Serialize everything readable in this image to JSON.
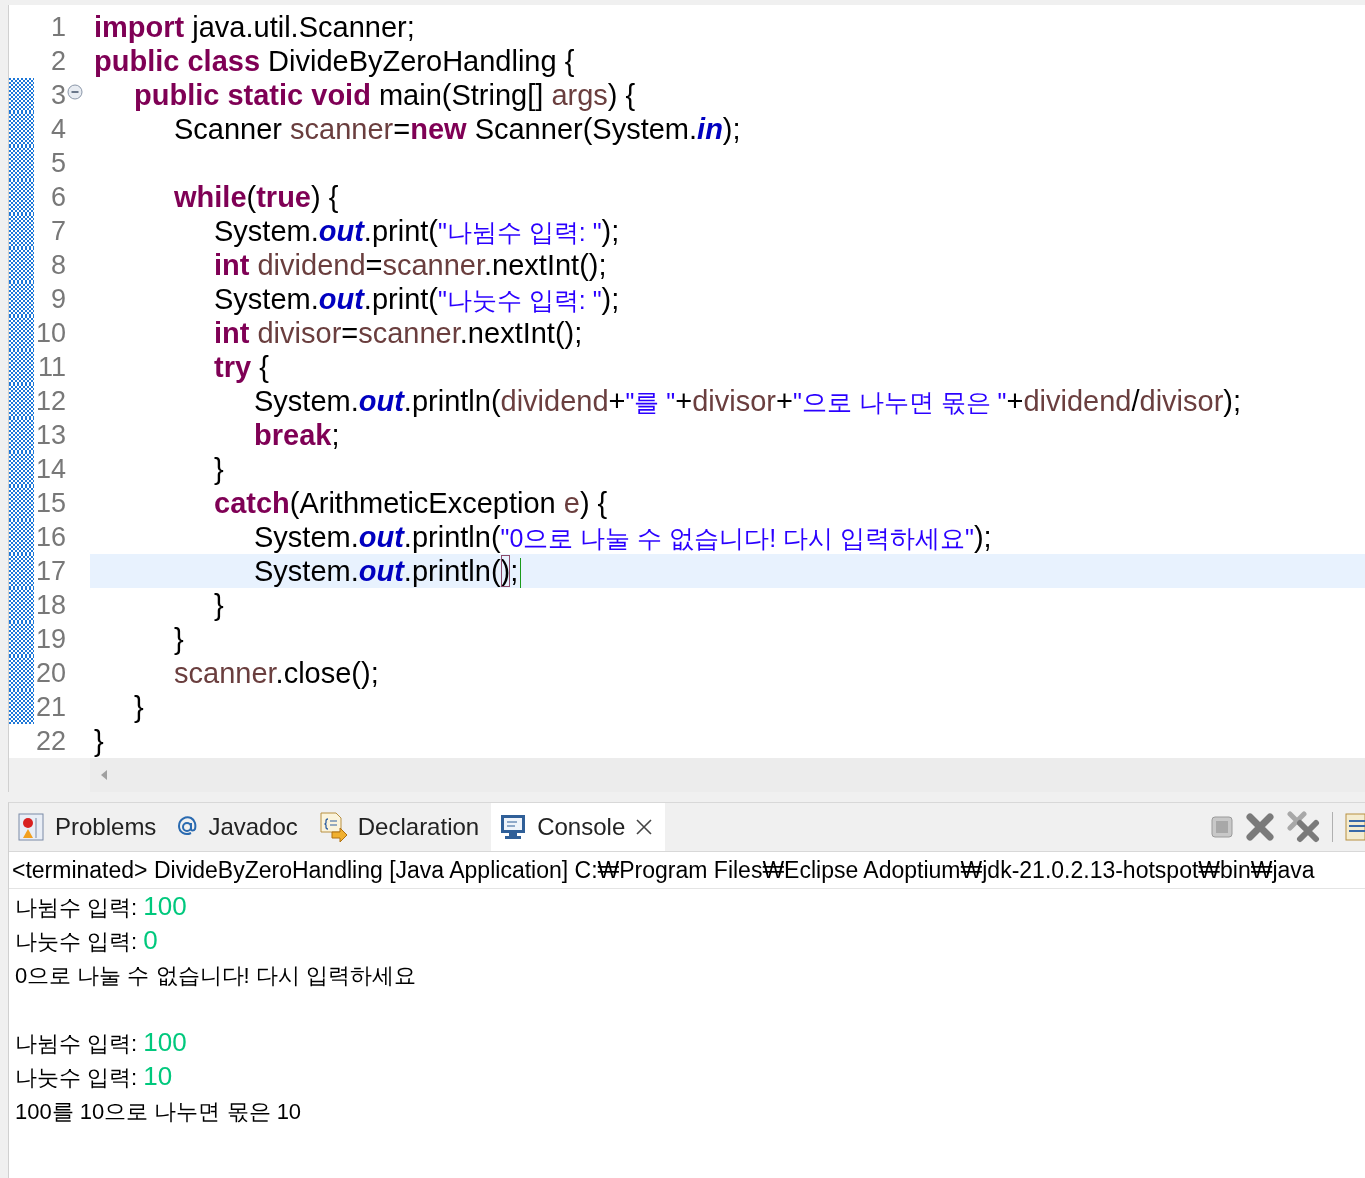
{
  "editor": {
    "lines": [
      {
        "number": "1",
        "changed": false,
        "current": false,
        "foldable": false,
        "tokens": [
          {
            "kind": "kw",
            "text": "import"
          },
          {
            "kind": "plain",
            "text": " java.util.Scanner;"
          }
        ]
      },
      {
        "number": "2",
        "changed": false,
        "current": false,
        "foldable": false,
        "tokens": [
          {
            "kind": "kw",
            "text": "public class"
          },
          {
            "kind": "plain",
            "text": " DivideByZeroHandling {"
          }
        ]
      },
      {
        "number": "3",
        "changed": true,
        "current": false,
        "foldable": true,
        "tokens": [
          {
            "kind": "kw",
            "text": "\tpublic static void"
          },
          {
            "kind": "plain",
            "text": " main(String[] "
          },
          {
            "kind": "var",
            "text": "args"
          },
          {
            "kind": "plain",
            "text": ") {"
          }
        ]
      },
      {
        "number": "4",
        "changed": true,
        "current": false,
        "foldable": false,
        "tokens": [
          {
            "kind": "plain",
            "text": "\t\tScanner "
          },
          {
            "kind": "var",
            "text": "scanner"
          },
          {
            "kind": "plain",
            "text": "="
          },
          {
            "kind": "kw",
            "text": "new"
          },
          {
            "kind": "plain",
            "text": " Scanner(System."
          },
          {
            "kind": "field",
            "text": "in"
          },
          {
            "kind": "plain",
            "text": ");"
          }
        ]
      },
      {
        "number": "5",
        "changed": true,
        "current": false,
        "foldable": false
      },
      {
        "number": "6",
        "changed": true,
        "current": false,
        "foldable": false,
        "tokens": [
          {
            "kind": "kw",
            "text": "\t\twhile"
          },
          {
            "kind": "plain",
            "text": "("
          },
          {
            "kind": "kw",
            "text": "true"
          },
          {
            "kind": "plain",
            "text": ") {"
          }
        ]
      },
      {
        "number": "7",
        "changed": true,
        "current": false,
        "foldable": false,
        "tokens": [
          {
            "kind": "plain",
            "text": "\t\t\tSystem."
          },
          {
            "kind": "field",
            "text": "out"
          },
          {
            "kind": "plain",
            "text": ".print("
          },
          {
            "kind": "str",
            "text": "\"나뉨수 입력: \""
          },
          {
            "kind": "plain",
            "text": ");"
          }
        ]
      },
      {
        "number": "8",
        "changed": true,
        "current": false,
        "foldable": false,
        "tokens": [
          {
            "kind": "kw",
            "text": "\t\t\tint"
          },
          {
            "kind": "var",
            "text": " dividend"
          },
          {
            "kind": "plain",
            "text": "="
          },
          {
            "kind": "var",
            "text": "scanner"
          },
          {
            "kind": "plain",
            "text": ".nextInt();"
          }
        ]
      },
      {
        "number": "9",
        "changed": true,
        "current": false,
        "foldable": false,
        "tokens": [
          {
            "kind": "plain",
            "text": "\t\t\tSystem."
          },
          {
            "kind": "field",
            "text": "out"
          },
          {
            "kind": "plain",
            "text": ".print("
          },
          {
            "kind": "str",
            "text": "\"나눗수 입력: \""
          },
          {
            "kind": "plain",
            "text": ");"
          }
        ]
      },
      {
        "number": "10",
        "changed": true,
        "current": false,
        "foldable": false,
        "tokens": [
          {
            "kind": "kw",
            "text": "\t\t\tint"
          },
          {
            "kind": "var",
            "text": " divisor"
          },
          {
            "kind": "plain",
            "text": "="
          },
          {
            "kind": "var",
            "text": "scanner"
          },
          {
            "kind": "plain",
            "text": ".nextInt();"
          }
        ]
      },
      {
        "number": "11",
        "changed": true,
        "current": false,
        "foldable": false,
        "tokens": [
          {
            "kind": "kw",
            "text": "\t\t\ttry"
          },
          {
            "kind": "plain",
            "text": " {"
          }
        ]
      },
      {
        "number": "12",
        "changed": true,
        "current": false,
        "foldable": false,
        "tokens": [
          {
            "kind": "plain",
            "text": "\t\t\t\tSystem."
          },
          {
            "kind": "field",
            "text": "out"
          },
          {
            "kind": "plain",
            "text": ".println("
          },
          {
            "kind": "var",
            "text": "dividend"
          },
          {
            "kind": "plain",
            "text": "+"
          },
          {
            "kind": "str",
            "text": "\"를 \""
          },
          {
            "kind": "plain",
            "text": "+"
          },
          {
            "kind": "var",
            "text": "divisor"
          },
          {
            "kind": "plain",
            "text": "+"
          },
          {
            "kind": "str",
            "text": "\"으로 나누면 몫은 \""
          },
          {
            "kind": "plain",
            "text": "+"
          },
          {
            "kind": "var",
            "text": "dividend"
          },
          {
            "kind": "plain",
            "text": "/"
          },
          {
            "kind": "var",
            "text": "divisor"
          },
          {
            "kind": "plain",
            "text": ");"
          }
        ]
      },
      {
        "number": "13",
        "changed": true,
        "current": false,
        "foldable": false,
        "tokens": [
          {
            "kind": "kw",
            "text": "\t\t\t\tbreak"
          },
          {
            "kind": "plain",
            "text": ";"
          }
        ]
      },
      {
        "number": "14",
        "changed": true,
        "current": false,
        "foldable": false,
        "tokens": [
          {
            "kind": "plain",
            "text": "\t\t\t}"
          }
        ]
      },
      {
        "number": "15",
        "changed": true,
        "current": false,
        "foldable": false,
        "tokens": [
          {
            "kind": "kw",
            "text": "\t\t\tcatch"
          },
          {
            "kind": "plain",
            "text": "(ArithmeticException "
          },
          {
            "kind": "var",
            "text": "e"
          },
          {
            "kind": "plain",
            "text": ") {"
          }
        ]
      },
      {
        "number": "16",
        "changed": true,
        "current": false,
        "foldable": false,
        "tokens": [
          {
            "kind": "plain",
            "text": "\t\t\t\tSystem."
          },
          {
            "kind": "field",
            "text": "out"
          },
          {
            "kind": "plain",
            "text": ".println("
          },
          {
            "kind": "str",
            "text": "\"0으로 나눌 수 없습니다! 다시 입력하세요\""
          },
          {
            "kind": "plain",
            "text": ");"
          }
        ]
      },
      {
        "number": "17",
        "changed": true,
        "current": true,
        "foldable": false,
        "tokens": [
          {
            "kind": "plain",
            "text": "\t\t\t\tSystem."
          },
          {
            "kind": "field",
            "text": "out"
          },
          {
            "kind": "plain",
            "text": ".println("
          },
          {
            "kind": "match",
            "text": ")"
          },
          {
            "kind": "plain",
            "text": ";"
          },
          {
            "kind": "caret"
          }
        ]
      },
      {
        "number": "18",
        "changed": true,
        "current": false,
        "foldable": false,
        "tokens": [
          {
            "kind": "plain",
            "text": "\t\t\t}"
          }
        ]
      },
      {
        "number": "19",
        "changed": true,
        "current": false,
        "foldable": false,
        "tokens": [
          {
            "kind": "plain",
            "text": "\t\t}"
          }
        ]
      },
      {
        "number": "20",
        "changed": true,
        "current": false,
        "foldable": false,
        "tokens": [
          {
            "kind": "var",
            "text": "\t\tscanner"
          },
          {
            "kind": "plain",
            "text": ".close();"
          }
        ]
      },
      {
        "number": "21",
        "changed": true,
        "current": false,
        "foldable": false,
        "tokens": [
          {
            "kind": "plain",
            "text": "\t}"
          }
        ]
      },
      {
        "number": "22",
        "changed": false,
        "current": false,
        "foldable": false,
        "tokens": [
          {
            "kind": "plain",
            "text": "}"
          }
        ]
      }
    ]
  },
  "panel": {
    "tabs": [
      {
        "kind": "problems",
        "label": "Problems",
        "selected": false,
        "closable": false
      },
      {
        "kind": "javadoc",
        "label": "Javadoc",
        "selected": false,
        "closable": false
      },
      {
        "kind": "declaration",
        "label": "Declaration",
        "selected": false,
        "closable": false
      },
      {
        "kind": "console",
        "label": "Console",
        "selected": true,
        "closable": true
      }
    ],
    "console": {
      "header": "<terminated> DivideByZeroHandling [Java Application] C:₩Program Files₩Eclipse Adoptium₩jdk-21.0.2.13-hotspot₩bin₩java",
      "lines": [
        {
          "spaced": false,
          "segments": [
            {
              "kind": "output",
              "text": "나뉨수 입력: "
            },
            {
              "kind": "input",
              "text": "100"
            }
          ]
        },
        {
          "spaced": false,
          "segments": [
            {
              "kind": "output",
              "text": "나눗수 입력: "
            },
            {
              "kind": "input",
              "text": "0"
            }
          ]
        },
        {
          "spaced": false,
          "segments": [
            {
              "kind": "output",
              "text": "0으로 나눌 수 없습니다! 다시 입력하세요"
            }
          ]
        },
        {
          "spaced": true,
          "segments": [
            {
              "kind": "output",
              "text": "나뉨수 입력: "
            },
            {
              "kind": "input",
              "text": "100"
            }
          ]
        },
        {
          "spaced": false,
          "segments": [
            {
              "kind": "output",
              "text": "나눗수 입력: "
            },
            {
              "kind": "input",
              "text": "10"
            }
          ]
        },
        {
          "spaced": false,
          "segments": [
            {
              "kind": "output",
              "text": "100를 10으로 나누면 몫은 10"
            }
          ]
        }
      ]
    }
  }
}
